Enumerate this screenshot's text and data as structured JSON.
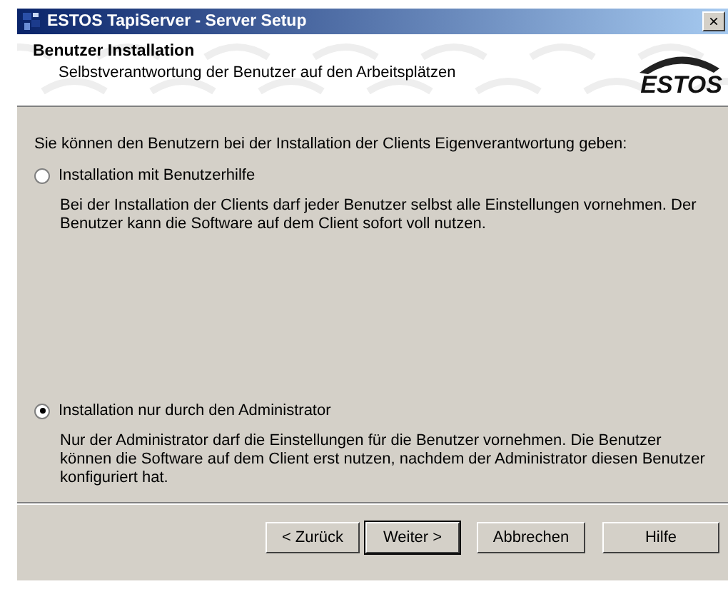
{
  "window": {
    "title": "ESTOS TapiServer - Server Setup",
    "close": "×"
  },
  "header": {
    "title": "Benutzer Installation",
    "subtitle": "Selbstverantwortung der Benutzer auf den Arbeitsplätzen",
    "logo": "ESTOS"
  },
  "intro": "Sie können den Benutzern bei der Installation der Clients Eigenverantwortung geben:",
  "options": [
    {
      "label": "Installation mit Benutzerhilfe",
      "selected": false,
      "description": "Bei der Installation der Clients darf jeder Benutzer selbst alle Einstellungen vornehmen. Der Benutzer kann die Software auf dem Client sofort voll nutzen."
    },
    {
      "label": "Installation nur durch den Administrator",
      "selected": true,
      "description": "Nur der Administrator darf die Einstellungen für die Benutzer vornehmen. Die Benutzer können die Software auf dem Client erst nutzen, nachdem der Administrator diesen Benutzer konfiguriert hat."
    }
  ],
  "buttons": [
    {
      "label": "< Zurück",
      "default": false
    },
    {
      "label": "Weiter >",
      "default": true
    },
    {
      "label": "Abbrechen",
      "default": false
    },
    {
      "label": "Hilfe",
      "default": false
    }
  ]
}
